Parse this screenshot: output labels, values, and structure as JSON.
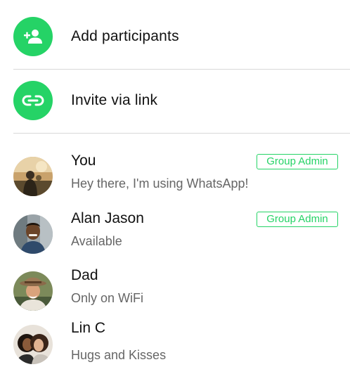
{
  "actions": {
    "add_participants": {
      "label": "Add participants",
      "icon": "add-person-icon"
    },
    "invite_link": {
      "label": "Invite via link",
      "icon": "link-icon"
    }
  },
  "colors": {
    "accent": "#25d366",
    "text_primary": "#111111",
    "text_secondary": "#666666",
    "divider": "#d8d8d8"
  },
  "members": [
    {
      "name": "You",
      "status": "Hey there, I'm using WhatsApp!",
      "badge": "Group Admin"
    },
    {
      "name": "Alan Jason",
      "status": "Available",
      "badge": "Group Admin"
    },
    {
      "name": "Dad",
      "status": "Only on WiFi"
    },
    {
      "name": "Lin C",
      "status": "Hugs and Kisses"
    }
  ]
}
